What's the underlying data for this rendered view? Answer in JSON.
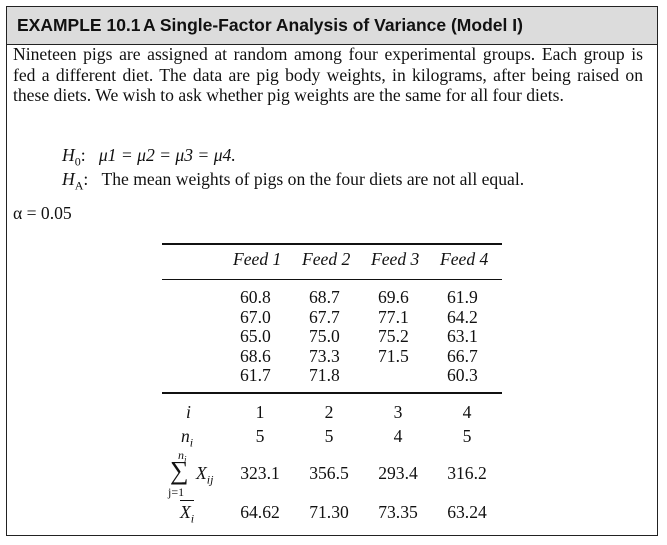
{
  "example": {
    "number": "EXAMPLE 10.1",
    "title": "A Single-Factor Analysis of Variance (Model I)"
  },
  "intro": "Nineteen pigs are assigned at random among four experimental groups. Each group is fed a different diet. The data are pig body weights, in kilograms, after being raised on these diets. We wish to ask whether pig weights are the same for all four diets.",
  "hypotheses": {
    "h0_label": "H",
    "h0_sub": "0",
    "h0_text": "μ1 = μ2 = μ3 = μ4.",
    "ha_label": "H",
    "ha_sub": "A",
    "ha_text": "The mean weights of pigs on the four diets are not all equal."
  },
  "alpha": "α = 0.05",
  "table": {
    "headers": [
      "Feed 1",
      "Feed 2",
      "Feed 3",
      "Feed 4"
    ],
    "columns": [
      [
        "60.8",
        "67.0",
        "65.0",
        "68.6",
        "61.7"
      ],
      [
        "68.7",
        "67.7",
        "75.0",
        "73.3",
        "71.8"
      ],
      [
        "69.6",
        "77.1",
        "75.2",
        "71.5"
      ],
      [
        "61.9",
        "64.2",
        "63.1",
        "66.7",
        "60.3"
      ]
    ],
    "row_labels": {
      "i": "i",
      "n": "n",
      "n_sub": "i",
      "sum_top": "n",
      "sum_top_sub": "i",
      "sum_symbol": "∑",
      "sum_term": "X",
      "sum_term_sub": "ij",
      "sum_bottom": "j=1",
      "mean": "X",
      "mean_sub": "i"
    },
    "i": [
      "1",
      "2",
      "3",
      "4"
    ],
    "n": [
      "5",
      "5",
      "4",
      "5"
    ],
    "sums": [
      "323.1",
      "356.5",
      "293.4",
      "316.2"
    ],
    "means": [
      "64.62",
      "71.30",
      "73.35",
      "63.24"
    ]
  }
}
